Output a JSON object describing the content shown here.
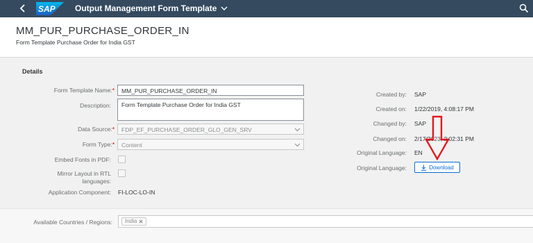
{
  "shell": {
    "logo_text": "SAP",
    "app_title": "Output Management Form Template"
  },
  "header": {
    "title": "MM_PUR_PURCHASE_ORDER_IN",
    "subtitle": "Form Template Purchase Order for India GST"
  },
  "details": {
    "section_title": "Details",
    "form_template_name": {
      "label": "Form Template Name:",
      "required": "*",
      "value": "MM_PUR_PURCHASE_ORDER_IN"
    },
    "description": {
      "label": "Description:",
      "value": "Form Template Purchase Order for India GST"
    },
    "data_source": {
      "label": "Data Source:",
      "required": "*",
      "value": "FDP_EF_PURCHASE_ORDER_GLO_GEN_SRV"
    },
    "form_type": {
      "label": "Form Type:",
      "required": "*",
      "value": "Content"
    },
    "embed_fonts": {
      "label": "Embed Fonts in PDF:",
      "checked": false
    },
    "mirror_layout": {
      "label_line1": "Mirror Layout in RTL",
      "label_line2": "languages:",
      "checked": false
    },
    "application_component": {
      "label": "Application Component:",
      "value": "FI-LOC-LO-IN"
    }
  },
  "admin": {
    "created_by": {
      "label": "Created by:",
      "value": "SAP"
    },
    "created_on": {
      "label": "Created on:",
      "value": "1/22/2019, 4:08:17 PM"
    },
    "changed_by": {
      "label": "Changed by:",
      "value": "SAP"
    },
    "changed_on": {
      "label": "Changed on:",
      "value": "2/17/2023, 2:02:31 PM"
    },
    "original_language": {
      "label": "Original Language:",
      "value": "EN"
    },
    "original_language_download": {
      "label": "Original Language:",
      "button_label": "Download"
    }
  },
  "countries": {
    "label": "Available Countries / Regions:",
    "tokens": [
      "India"
    ]
  },
  "colors": {
    "shell_bg": "#354a5f",
    "accent": "#0a6ed1",
    "required": "#bb0000",
    "annotation": "#e0191e"
  },
  "icons": {
    "back": "back-icon",
    "search": "search-icon",
    "title_menu": "chevron-down-icon",
    "dropdown": "chevron-down-icon",
    "download": "download-icon",
    "token_remove": "close-icon"
  }
}
